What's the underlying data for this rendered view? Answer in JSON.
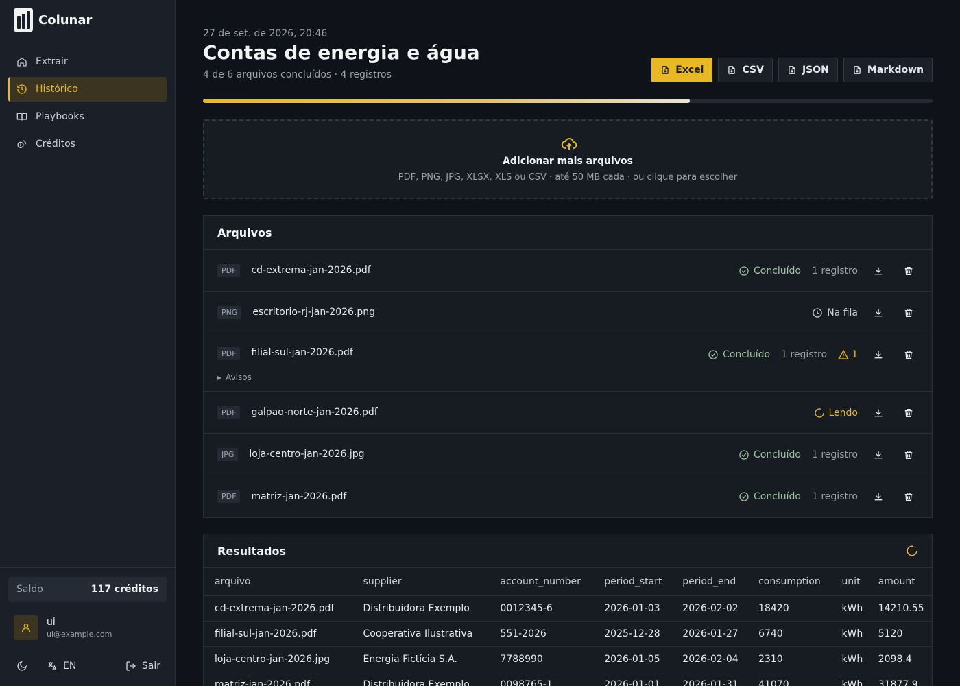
{
  "app": {
    "name": "Colunar"
  },
  "sidebar": {
    "items": [
      {
        "label": "Extrair",
        "icon": "home-icon"
      },
      {
        "label": "Histórico",
        "icon": "history-icon",
        "active": true
      },
      {
        "label": "Playbooks",
        "icon": "book-icon"
      },
      {
        "label": "Créditos",
        "icon": "coins-icon"
      }
    ],
    "balance_label": "Saldo",
    "balance_value": "117 créditos",
    "user_name": "ui",
    "user_email": "ui@example.com",
    "lang": "EN",
    "logout": "Sair"
  },
  "header": {
    "date": "27 de set. de 2026, 20:46",
    "title": "Contas de energia e água",
    "subtitle": "4 de 6 arquivos concluídos · 4 registros",
    "exports": [
      "Excel",
      "CSV",
      "JSON",
      "Markdown"
    ],
    "progress": 0.667
  },
  "dropzone": {
    "title": "Adicionar mais arquivos",
    "subtitle": "PDF, PNG, JPG, XLSX, XLS ou CSV · até 50 MB cada · ou clique para escolher"
  },
  "files": {
    "title": "Arquivos",
    "rows": [
      {
        "type": "PDF",
        "name": "cd-extrema-jan-2026.pdf",
        "status": "Concluído",
        "status_kind": "done",
        "records": "1 registro",
        "warnings": ""
      },
      {
        "type": "PNG",
        "name": "escritorio-rj-jan-2026.png",
        "status": "Na fila",
        "status_kind": "queue",
        "records": "",
        "warnings": ""
      },
      {
        "type": "PDF",
        "name": "filial-sul-jan-2026.pdf",
        "status": "Concluído",
        "status_kind": "done",
        "records": "1 registro",
        "warnings": "1",
        "details": "Avisos"
      },
      {
        "type": "PDF",
        "name": "galpao-norte-jan-2026.pdf",
        "status": "Lendo",
        "status_kind": "read",
        "records": "",
        "warnings": ""
      },
      {
        "type": "JPG",
        "name": "loja-centro-jan-2026.jpg",
        "status": "Concluído",
        "status_kind": "done",
        "records": "1 registro",
        "warnings": ""
      },
      {
        "type": "PDF",
        "name": "matriz-jan-2026.pdf",
        "status": "Concluído",
        "status_kind": "done",
        "records": "1 registro",
        "warnings": ""
      }
    ]
  },
  "results": {
    "title": "Resultados",
    "columns": [
      "arquivo",
      "supplier",
      "account_number",
      "period_start",
      "period_end",
      "consumption",
      "unit",
      "amount"
    ],
    "rows": [
      [
        "cd-extrema-jan-2026.pdf",
        "Distribuidora Exemplo",
        "0012345-6",
        "2026-01-03",
        "2026-02-02",
        "18420",
        "kWh",
        "14210.55"
      ],
      [
        "filial-sul-jan-2026.pdf",
        "Cooperativa Ilustrativa",
        "551-2026",
        "2025-12-28",
        "2026-01-27",
        "6740",
        "kWh",
        "5120"
      ],
      [
        "loja-centro-jan-2026.jpg",
        "Energia Fictícia S.A.",
        "7788990",
        "2026-01-05",
        "2026-02-04",
        "2310",
        "kWh",
        "2098.4"
      ],
      [
        "matriz-jan-2026.pdf",
        "Distribuidora Exemplo",
        "0098765-1",
        "2026-01-01",
        "2026-01-31",
        "41070",
        "kWh",
        "31877.9"
      ]
    ]
  },
  "colors": {
    "accent": "#e8b923",
    "done": "#9cc3a0",
    "bg": "#0f1218",
    "panel": "#171b22"
  }
}
